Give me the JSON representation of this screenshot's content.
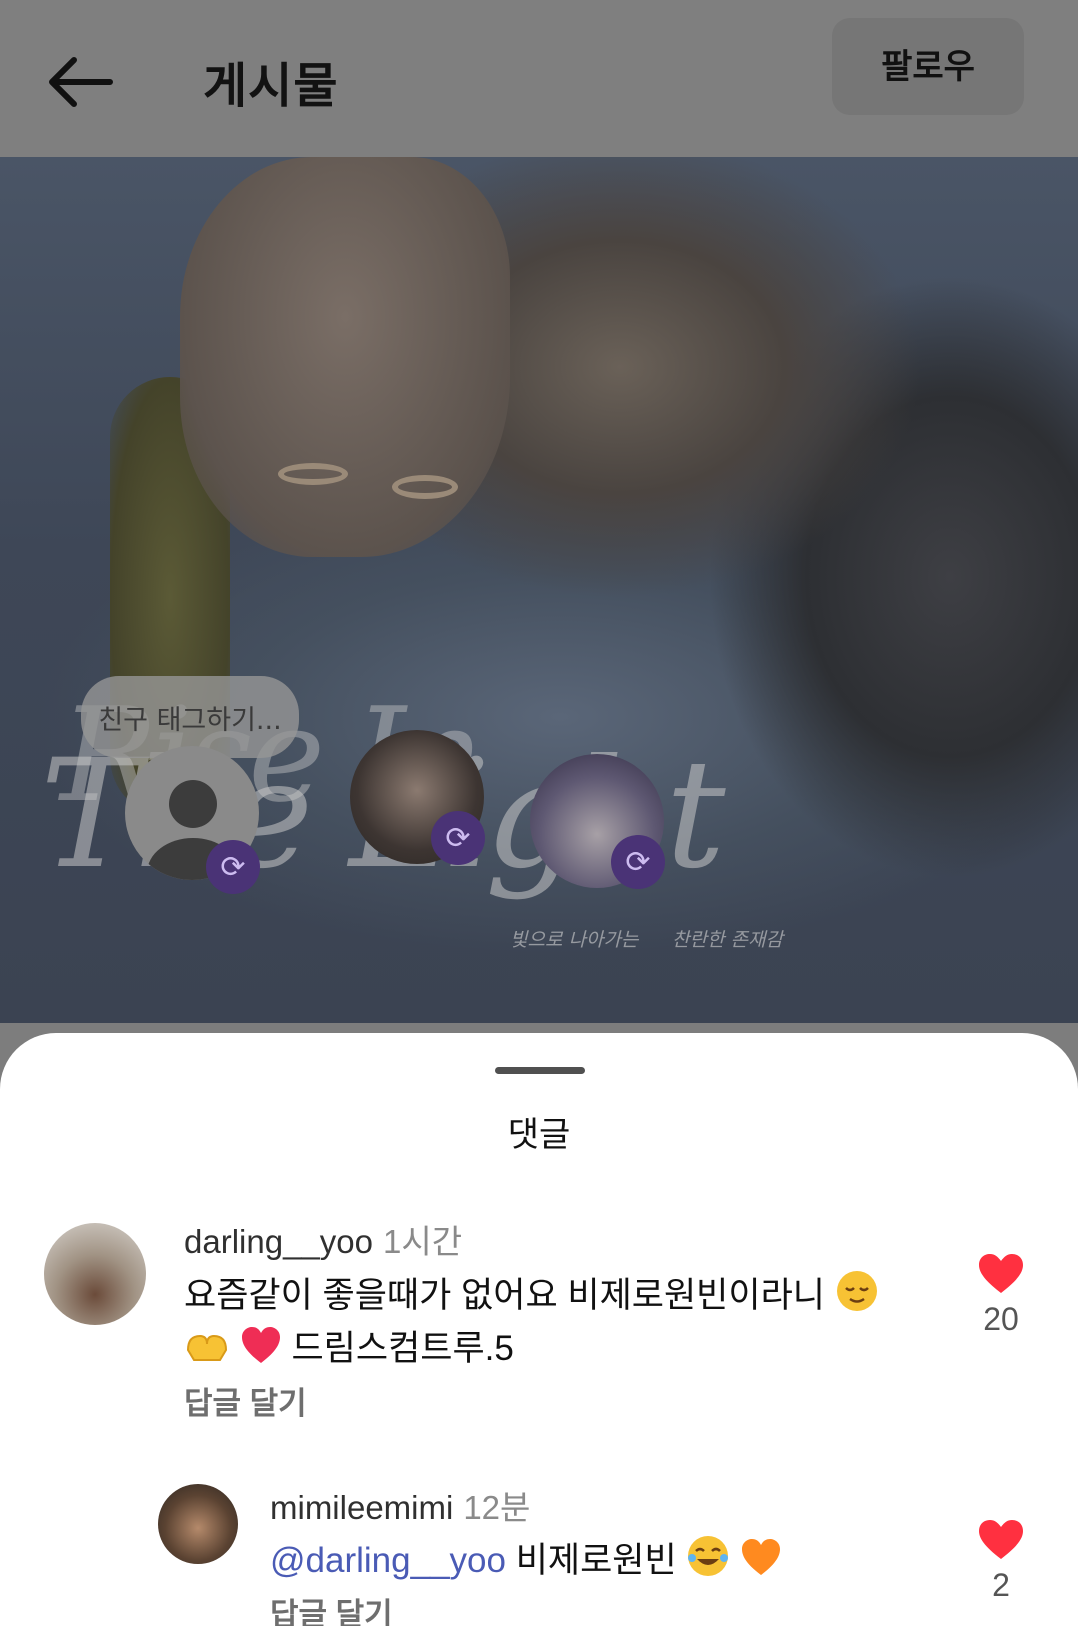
{
  "header": {
    "title": "게시물",
    "follow_label": "팔로우"
  },
  "photo": {
    "tag_placeholder": "친구 태그하기...",
    "script_title": "The Light",
    "script_title_top": "Rise In",
    "caption_left": "빛으로 나아가는",
    "caption_right": "찬란한 존재감"
  },
  "comments_sheet": {
    "title": "댓글",
    "comments": [
      {
        "user": "darling__yoo",
        "time": "1시간",
        "line1": "요즘같이 좋을때가 없어요 비제로원빈이라니",
        "line2": "드림스컴트루.5",
        "reply_label": "답글 달기",
        "likes": "20"
      },
      {
        "user": "mimileemimi",
        "time": "12분",
        "mention": "@darling__yoo",
        "text": " 비제로원빈 ",
        "reply_label": "답글 달기",
        "likes": "2"
      }
    ]
  },
  "colors": {
    "heart": "#ff3040",
    "mention": "#4a5bb5",
    "sync_badge": "#4a3376"
  }
}
